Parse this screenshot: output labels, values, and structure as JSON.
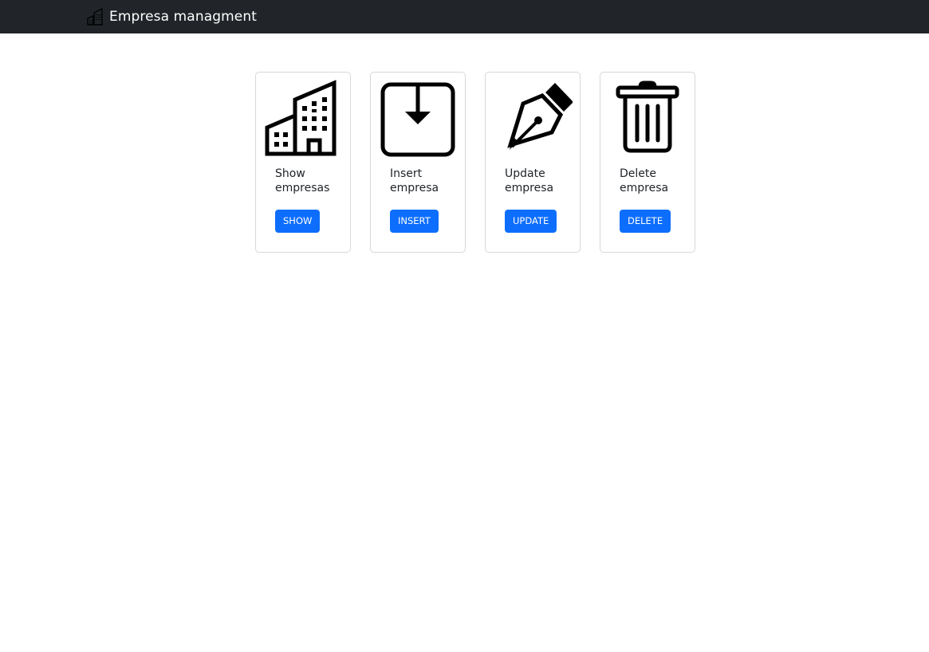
{
  "navbar": {
    "brand_icon": "buildings-icon",
    "brand_text": "Empresa managment"
  },
  "cards": [
    {
      "icon": "buildings-icon",
      "title": "Show empresas",
      "button": "SHOW"
    },
    {
      "icon": "download-box-icon",
      "title": "Insert empresa",
      "button": "INSERT"
    },
    {
      "icon": "pen-nib-icon",
      "title": "Update empresa",
      "button": "UPDATE"
    },
    {
      "icon": "trash-icon",
      "title": "Delete empresa",
      "button": "DELETE"
    }
  ],
  "colors": {
    "navbar_bg": "#212529",
    "button_bg": "#0d6efd",
    "card_border": "#d8d8d8"
  }
}
